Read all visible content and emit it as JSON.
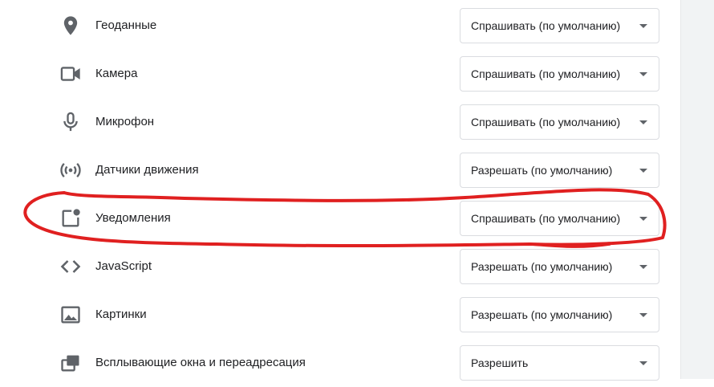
{
  "settings": {
    "rows": [
      {
        "label": "Геоданные",
        "value": "Спрашивать (по умолчанию)",
        "icon": "location-pin-icon"
      },
      {
        "label": "Камера",
        "value": "Спрашивать (по умолчанию)",
        "icon": "camera-icon"
      },
      {
        "label": "Микрофон",
        "value": "Спрашивать (по умолчанию)",
        "icon": "microphone-icon"
      },
      {
        "label": "Датчики движения",
        "value": "Разрешать (по умолчанию)",
        "icon": "motion-sensor-icon"
      },
      {
        "label": "Уведомления",
        "value": "Спрашивать (по умолчанию)",
        "icon": "notification-icon"
      },
      {
        "label": "JavaScript",
        "value": "Разрешать (по умолчанию)",
        "icon": "code-icon"
      },
      {
        "label": "Картинки",
        "value": "Разрешать (по умолчанию)",
        "icon": "image-icon"
      },
      {
        "label": "Всплывающие окна и переадресация",
        "value": "Разрешить",
        "icon": "popup-icon"
      }
    ]
  },
  "colors": {
    "icon": "#5f6368",
    "highlight": "#e02020",
    "text": "#202124"
  }
}
